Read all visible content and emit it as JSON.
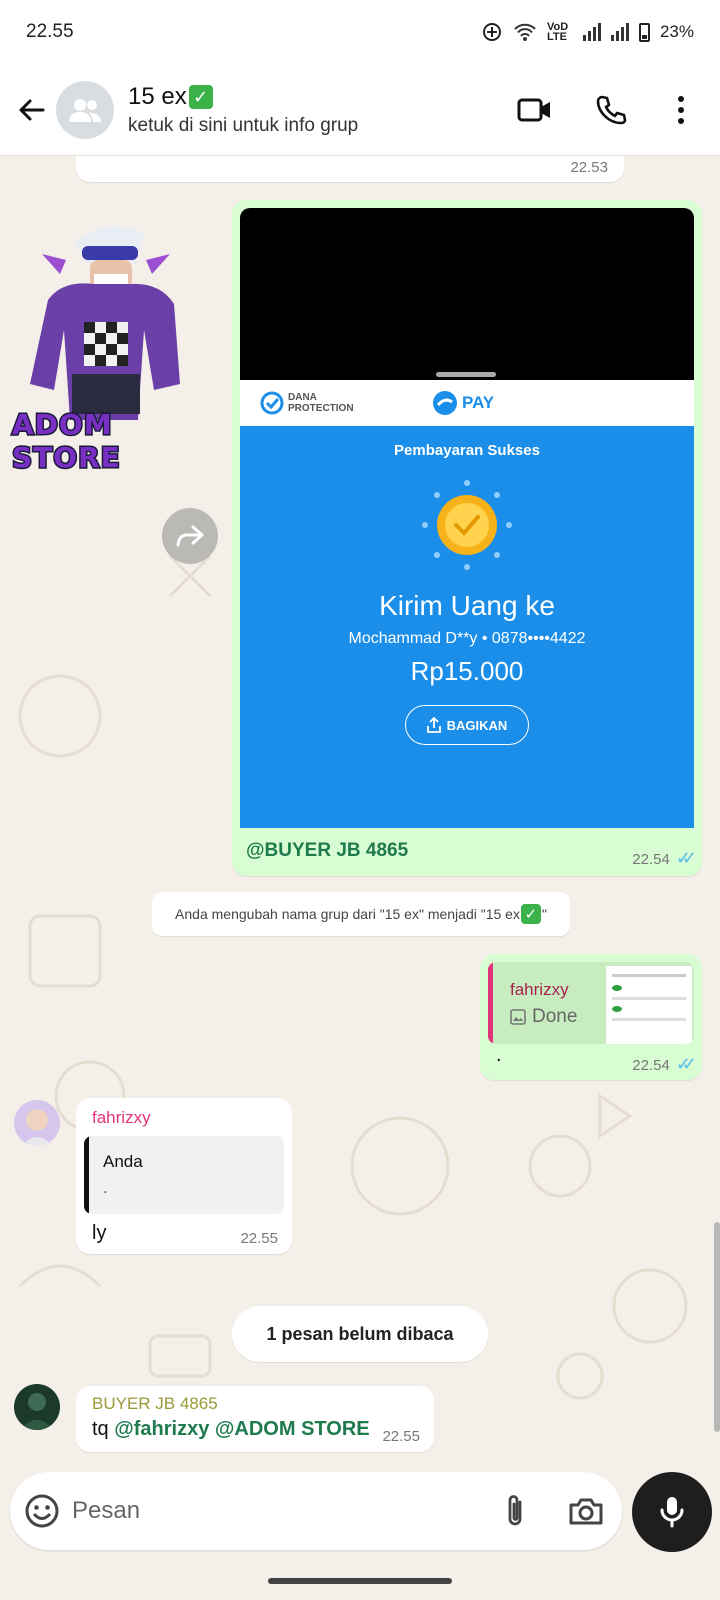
{
  "status": {
    "time": "22.55",
    "network": "VoD LTE",
    "battery": "23%"
  },
  "header": {
    "title": "15 ex",
    "subtitle": "ketuk di sini untuk info grup"
  },
  "messages": {
    "prev_time": "22.53",
    "sticker_text": "ADOM STORE",
    "payment": {
      "protection": "DANA PROTECTION",
      "brand": "PAY",
      "status": "Pembayaran Sukses",
      "title": "Kirim Uang ke",
      "recipient": "Mochammad D**y • 0878••••4422",
      "amount": "Rp15.000",
      "share": "BAGIKAN",
      "caption": "@BUYER JB 4865",
      "time": "22.54"
    },
    "system_notice": "Anda mengubah nama grup dari \"15 ex\" menjadi \"15 ex",
    "system_notice_end": "\"",
    "reply_out": {
      "quoted_author": "fahrizxy",
      "quoted_text": "Done",
      "text": ".",
      "time": "22.54"
    },
    "incoming1": {
      "author": "fahrizxy",
      "quoted_author": "Anda",
      "quoted_text": ".",
      "text": "ly",
      "time": "22.55"
    },
    "unread": "1 pesan belum dibaca",
    "incoming2": {
      "author": "BUYER JB 4865",
      "text_prefix": "tq ",
      "mention1": "@fahrizxy",
      "mention2": "@ADOM STORE",
      "time": "22.55"
    }
  },
  "composer": {
    "placeholder": "Pesan"
  },
  "colors": {
    "accent_green": "#1f7a4d",
    "outgoing_bubble": "#d9fdd3",
    "pink_author": "#e0357b",
    "olive_author": "#9a9a3a",
    "tick_blue": "#53bdeb",
    "dana_blue": "#1a8ee9"
  },
  "icons": [
    "back-arrow-icon",
    "group-icon",
    "video-call-icon",
    "phone-icon",
    "more-icon",
    "forward-icon",
    "emoji-icon",
    "attach-icon",
    "camera-icon",
    "mic-icon",
    "image-icon",
    "share-icon"
  ]
}
